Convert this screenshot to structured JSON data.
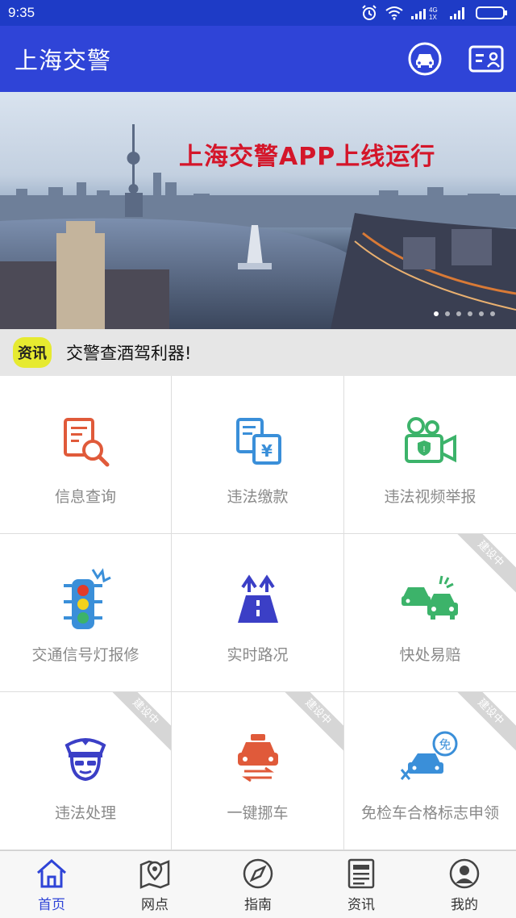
{
  "status": {
    "time": "9:35",
    "network": "4G",
    "network_sub": "1X"
  },
  "app_bar": {
    "title": "上海交警"
  },
  "banner": {
    "headline": "上海交警APP上线运行"
  },
  "news": {
    "badge": "资讯",
    "text": "交警查酒驾利器!"
  },
  "grid": {
    "items": [
      {
        "label": "信息查询",
        "icon": "document-search-icon",
        "color": "#e05a3a"
      },
      {
        "label": "违法缴款",
        "icon": "payment-doc-icon",
        "color": "#3a8fd9"
      },
      {
        "label": "违法视频举报",
        "icon": "video-camera-icon",
        "color": "#3cb36a"
      },
      {
        "label": "交通信号灯报修",
        "icon": "traffic-light-icon",
        "color": "#3a8fd9"
      },
      {
        "label": "实时路况",
        "icon": "road-icon",
        "color": "#3b3fc6"
      },
      {
        "label": "快处易赔",
        "icon": "car-accident-icon",
        "color": "#3cb36a",
        "badge": "建设中"
      },
      {
        "label": "违法处理",
        "icon": "police-icon",
        "color": "#3b3fc6",
        "badge": "建设中"
      },
      {
        "label": "一键挪车",
        "icon": "move-car-icon",
        "color": "#e05a3a",
        "badge": "建设中"
      },
      {
        "label": "免检车合格标志申领",
        "icon": "exempt-car-icon",
        "color": "#3a8fd9",
        "badge": "建设中"
      }
    ]
  },
  "tabs": [
    {
      "label": "首页",
      "icon": "home-icon"
    },
    {
      "label": "网点",
      "icon": "map-pin-icon"
    },
    {
      "label": "指南",
      "icon": "compass-icon"
    },
    {
      "label": "资讯",
      "icon": "news-icon"
    },
    {
      "label": "我的",
      "icon": "user-icon"
    }
  ],
  "colors": {
    "primary": "#2f44d7",
    "status_bar": "#1e3bc6",
    "badge_yellow": "#e6ea30",
    "headline_red": "#d4162a"
  }
}
